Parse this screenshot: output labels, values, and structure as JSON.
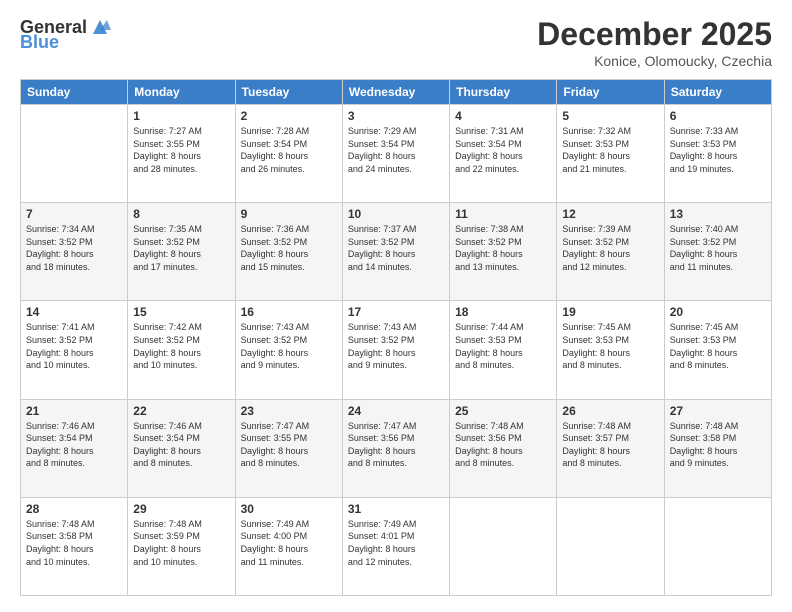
{
  "logo": {
    "general": "General",
    "blue": "Blue"
  },
  "header": {
    "month": "December 2025",
    "location": "Konice, Olomoucky, Czechia"
  },
  "weekdays": [
    "Sunday",
    "Monday",
    "Tuesday",
    "Wednesday",
    "Thursday",
    "Friday",
    "Saturday"
  ],
  "weeks": [
    [
      {
        "day": "",
        "info": ""
      },
      {
        "day": "1",
        "info": "Sunrise: 7:27 AM\nSunset: 3:55 PM\nDaylight: 8 hours\nand 28 minutes."
      },
      {
        "day": "2",
        "info": "Sunrise: 7:28 AM\nSunset: 3:54 PM\nDaylight: 8 hours\nand 26 minutes."
      },
      {
        "day": "3",
        "info": "Sunrise: 7:29 AM\nSunset: 3:54 PM\nDaylight: 8 hours\nand 24 minutes."
      },
      {
        "day": "4",
        "info": "Sunrise: 7:31 AM\nSunset: 3:54 PM\nDaylight: 8 hours\nand 22 minutes."
      },
      {
        "day": "5",
        "info": "Sunrise: 7:32 AM\nSunset: 3:53 PM\nDaylight: 8 hours\nand 21 minutes."
      },
      {
        "day": "6",
        "info": "Sunrise: 7:33 AM\nSunset: 3:53 PM\nDaylight: 8 hours\nand 19 minutes."
      }
    ],
    [
      {
        "day": "7",
        "info": "Sunrise: 7:34 AM\nSunset: 3:52 PM\nDaylight: 8 hours\nand 18 minutes."
      },
      {
        "day": "8",
        "info": "Sunrise: 7:35 AM\nSunset: 3:52 PM\nDaylight: 8 hours\nand 17 minutes."
      },
      {
        "day": "9",
        "info": "Sunrise: 7:36 AM\nSunset: 3:52 PM\nDaylight: 8 hours\nand 15 minutes."
      },
      {
        "day": "10",
        "info": "Sunrise: 7:37 AM\nSunset: 3:52 PM\nDaylight: 8 hours\nand 14 minutes."
      },
      {
        "day": "11",
        "info": "Sunrise: 7:38 AM\nSunset: 3:52 PM\nDaylight: 8 hours\nand 13 minutes."
      },
      {
        "day": "12",
        "info": "Sunrise: 7:39 AM\nSunset: 3:52 PM\nDaylight: 8 hours\nand 12 minutes."
      },
      {
        "day": "13",
        "info": "Sunrise: 7:40 AM\nSunset: 3:52 PM\nDaylight: 8 hours\nand 11 minutes."
      }
    ],
    [
      {
        "day": "14",
        "info": "Sunrise: 7:41 AM\nSunset: 3:52 PM\nDaylight: 8 hours\nand 10 minutes."
      },
      {
        "day": "15",
        "info": "Sunrise: 7:42 AM\nSunset: 3:52 PM\nDaylight: 8 hours\nand 10 minutes."
      },
      {
        "day": "16",
        "info": "Sunrise: 7:43 AM\nSunset: 3:52 PM\nDaylight: 8 hours\nand 9 minutes."
      },
      {
        "day": "17",
        "info": "Sunrise: 7:43 AM\nSunset: 3:52 PM\nDaylight: 8 hours\nand 9 minutes."
      },
      {
        "day": "18",
        "info": "Sunrise: 7:44 AM\nSunset: 3:53 PM\nDaylight: 8 hours\nand 8 minutes."
      },
      {
        "day": "19",
        "info": "Sunrise: 7:45 AM\nSunset: 3:53 PM\nDaylight: 8 hours\nand 8 minutes."
      },
      {
        "day": "20",
        "info": "Sunrise: 7:45 AM\nSunset: 3:53 PM\nDaylight: 8 hours\nand 8 minutes."
      }
    ],
    [
      {
        "day": "21",
        "info": "Sunrise: 7:46 AM\nSunset: 3:54 PM\nDaylight: 8 hours\nand 8 minutes."
      },
      {
        "day": "22",
        "info": "Sunrise: 7:46 AM\nSunset: 3:54 PM\nDaylight: 8 hours\nand 8 minutes."
      },
      {
        "day": "23",
        "info": "Sunrise: 7:47 AM\nSunset: 3:55 PM\nDaylight: 8 hours\nand 8 minutes."
      },
      {
        "day": "24",
        "info": "Sunrise: 7:47 AM\nSunset: 3:56 PM\nDaylight: 8 hours\nand 8 minutes."
      },
      {
        "day": "25",
        "info": "Sunrise: 7:48 AM\nSunset: 3:56 PM\nDaylight: 8 hours\nand 8 minutes."
      },
      {
        "day": "26",
        "info": "Sunrise: 7:48 AM\nSunset: 3:57 PM\nDaylight: 8 hours\nand 8 minutes."
      },
      {
        "day": "27",
        "info": "Sunrise: 7:48 AM\nSunset: 3:58 PM\nDaylight: 8 hours\nand 9 minutes."
      }
    ],
    [
      {
        "day": "28",
        "info": "Sunrise: 7:48 AM\nSunset: 3:58 PM\nDaylight: 8 hours\nand 10 minutes."
      },
      {
        "day": "29",
        "info": "Sunrise: 7:48 AM\nSunset: 3:59 PM\nDaylight: 8 hours\nand 10 minutes."
      },
      {
        "day": "30",
        "info": "Sunrise: 7:49 AM\nSunset: 4:00 PM\nDaylight: 8 hours\nand 11 minutes."
      },
      {
        "day": "31",
        "info": "Sunrise: 7:49 AM\nSunset: 4:01 PM\nDaylight: 8 hours\nand 12 minutes."
      },
      {
        "day": "",
        "info": ""
      },
      {
        "day": "",
        "info": ""
      },
      {
        "day": "",
        "info": ""
      }
    ]
  ]
}
